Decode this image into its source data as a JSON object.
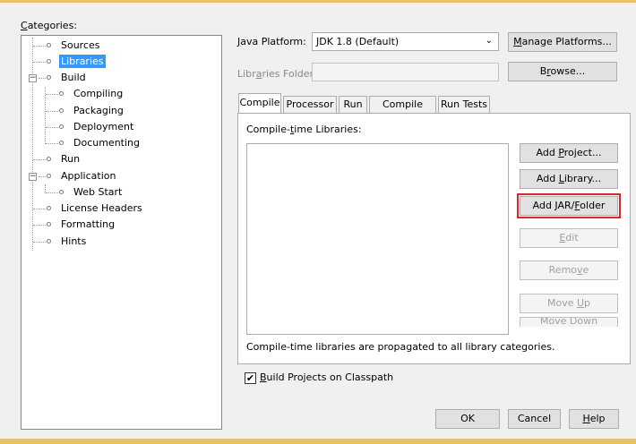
{
  "categories": {
    "label_first": "C",
    "label_rest": "ategories:",
    "items": [
      {
        "label": "Sources"
      },
      {
        "label": "Libraries"
      },
      {
        "label": "Build"
      },
      {
        "label": "Compiling"
      },
      {
        "label": "Packaging"
      },
      {
        "label": "Deployment"
      },
      {
        "label": "Documenting"
      },
      {
        "label": "Run"
      },
      {
        "label": "Application"
      },
      {
        "label": "Web Start"
      },
      {
        "label": "License Headers"
      },
      {
        "label": "Formatting"
      },
      {
        "label": "Hints"
      }
    ],
    "selected": "Libraries"
  },
  "platform": {
    "label_first": "J",
    "label_rest": "ava Platform:",
    "value": "JDK 1.8 (Default)",
    "manage_first": "M",
    "manage_rest": "anage Platforms..."
  },
  "libraries_folder": {
    "label_a": "Libr",
    "label_u": "a",
    "label_b": "ries Folder:",
    "value": "",
    "browse_a": "B",
    "browse_u": "r",
    "browse_b": "owse..."
  },
  "tabs": [
    {
      "label": "Compile"
    },
    {
      "label": "Processor"
    },
    {
      "label": "Run"
    },
    {
      "label": "Compile Tests"
    },
    {
      "label": "Run Tests"
    }
  ],
  "compile": {
    "libs_label_a": "Compile-",
    "libs_label_u": "t",
    "libs_label_b": "ime Libraries:",
    "note": "Compile-time libraries are propagated to all library categories.",
    "buttons": {
      "add_project_a": "Add ",
      "add_project_u": "P",
      "add_project_b": "roject...",
      "add_library_a": "Add ",
      "add_library_u": "L",
      "add_library_b": "ibrary...",
      "add_jar_a": "Add JAR/",
      "add_jar_u": "F",
      "add_jar_b": "older",
      "edit_u": "E",
      "edit_b": "dit",
      "remove_a": "Remo",
      "remove_u": "v",
      "remove_b": "e",
      "move_up_a": "Move ",
      "move_up_u": "U",
      "move_up_b": "p",
      "move_down": "Move Down"
    }
  },
  "build_on_classpath": {
    "checked": true,
    "label_u": "B",
    "label_b": "uild Projects on Classpath"
  },
  "footer": {
    "ok": "OK",
    "cancel": "Cancel",
    "help_u": "H",
    "help_b": "elp"
  },
  "colors": {
    "selection": "#3399ff",
    "highlight_border": "#d9262c",
    "window_edge": "#e8c069"
  }
}
